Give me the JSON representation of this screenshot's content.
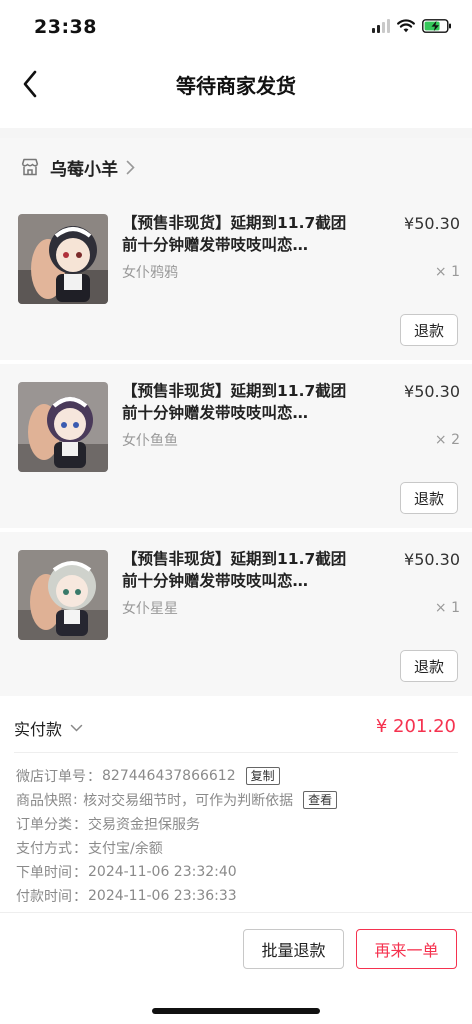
{
  "status_bar": {
    "time": "23:38"
  },
  "nav": {
    "title": "等待商家发货",
    "back_icon": "chevron-left-icon"
  },
  "shop": {
    "name": "乌莓小羊",
    "icon": "store-icon"
  },
  "items": [
    {
      "title": "【预售非现货】延期到11.7截团前十分钟赠发带吱吱叫恋…",
      "price": "¥50.30",
      "variant": "女仆鸦鸦",
      "qty": "× 1",
      "refund_label": "退款"
    },
    {
      "title": "【预售非现货】延期到11.7截团前十分钟赠发带吱吱叫恋…",
      "price": "¥50.30",
      "variant": "女仆鱼鱼",
      "qty": "× 2",
      "refund_label": "退款"
    },
    {
      "title": "【预售非现货】延期到11.7截团前十分钟赠发带吱吱叫恋…",
      "price": "¥50.30",
      "variant": "女仆星星",
      "qty": "× 1",
      "refund_label": "退款"
    }
  ],
  "payment": {
    "label": "实付款",
    "amount": "¥ 201.20"
  },
  "order_info": {
    "order_no_label": "微店订单号",
    "order_no": "827446437866612",
    "copy_label": "复制",
    "snapshot_label": "商品快照",
    "snapshot_value": "核对交易细节时，可作为判断依据",
    "view_label": "查看",
    "category_label": "订单分类",
    "category_value": "交易资金担保服务",
    "method_label": "支付方式",
    "method_value": "支付宝/余额",
    "order_time_label": "下单时间",
    "order_time": "2024-11-06 23:32:40",
    "pay_time_label": "付款时间",
    "pay_time": "2024-11-06 23:36:33"
  },
  "actions": {
    "batch_refund": "批量退款",
    "buy_again": "再来一单"
  },
  "colors": {
    "accent": "#f5324f",
    "muted": "#8a8a8a",
    "panel": "#f7f7f7",
    "battery": "#34c759"
  }
}
